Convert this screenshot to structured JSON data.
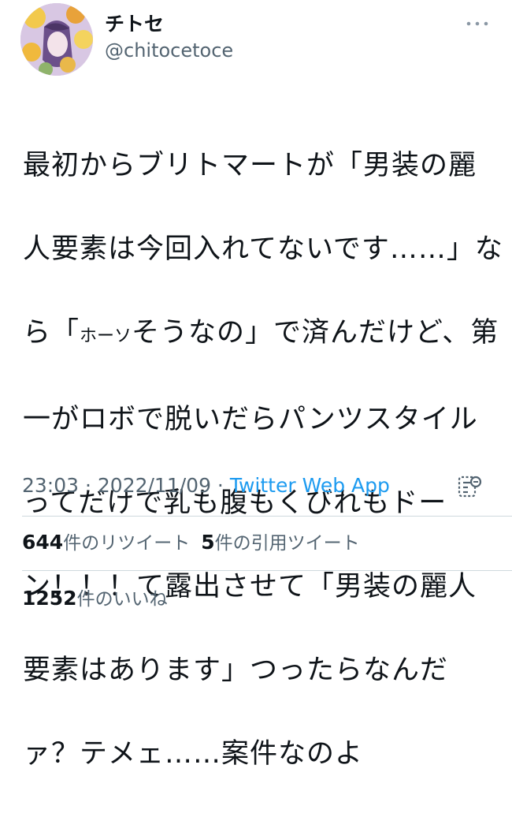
{
  "author": {
    "display_name": "チトセ",
    "handle": "@chitocetoce"
  },
  "tweet": {
    "lines": [
      "最初からブリトマートが「男装の麗",
      "人要素は今回入れてないです……」な",
      "ら「",
      "ホーソ",
      "そうなの」で済んだけど、第",
      "一がロボで脱いだらパンツスタイル",
      "ってだけで乳も腹もくびれもドー",
      "ン！！！て露出させて「男装の麗人",
      "要素はあります」つったらなんだ",
      "ァ？テメェ……案件なのよ"
    ]
  },
  "meta": {
    "time": "23:03",
    "separator": " · ",
    "date": "2022/11/09",
    "source": "Twitter Web App"
  },
  "stats": {
    "retweets_count": "644",
    "retweets_label": "件のリツイート",
    "quotes_count": "5",
    "quotes_label": "件の引用ツイート",
    "likes_count": "1252",
    "likes_label": "件のいいね"
  },
  "colors": {
    "text": "#0f1419",
    "secondary": "#536471",
    "link": "#1d9bf0",
    "divider": "#cfd9de"
  },
  "icons": {
    "more": "more-horizontal-icon",
    "analytics": "analytics-icon"
  }
}
